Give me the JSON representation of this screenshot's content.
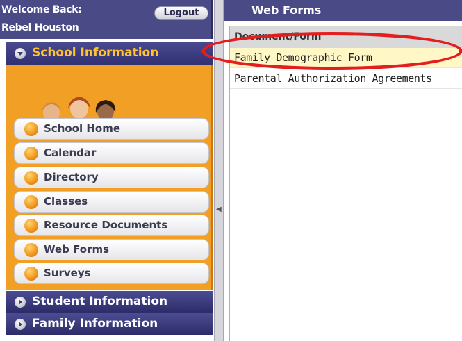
{
  "welcome": {
    "greeting": "Welcome Back:",
    "user_name": "Rebel Houston",
    "logout_label": "Logout"
  },
  "sidebar": {
    "sections": [
      {
        "label": "School Information",
        "expanded": true
      },
      {
        "label": "Student Information",
        "expanded": false
      },
      {
        "label": "Family Information",
        "expanded": false
      }
    ],
    "school_items": [
      {
        "label": "School Home"
      },
      {
        "label": "Calendar"
      },
      {
        "label": "Directory"
      },
      {
        "label": "Classes"
      },
      {
        "label": "Resource Documents"
      },
      {
        "label": "Web Forms"
      },
      {
        "label": "Surveys"
      }
    ]
  },
  "main": {
    "title": "Web Forms",
    "column_header": "Document/Form",
    "rows": [
      {
        "label": "Family Demographic Form",
        "selected": true
      },
      {
        "label": "Parental Authorization Agreements",
        "selected": false
      }
    ]
  },
  "colors": {
    "header_bg": "#4a4a86",
    "active_section_text": "#ffc230",
    "panel_orange": "#f19f25",
    "selected_row": "#fff7c6",
    "highlight_oval": "#e41e1e"
  }
}
